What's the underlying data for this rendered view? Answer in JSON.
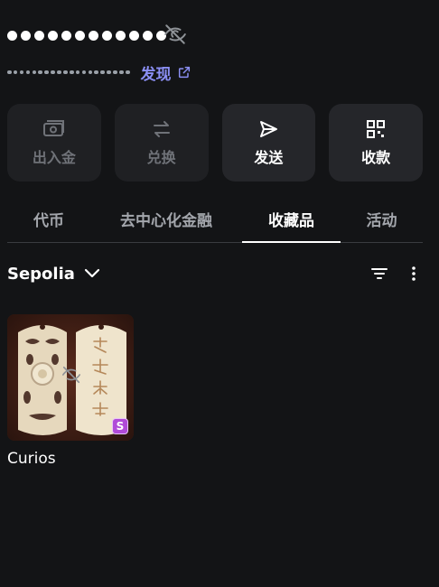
{
  "wallet": {
    "balance_hidden": true,
    "balance_dot_count": 12,
    "address_dot_count": 20,
    "discover_label": "发现"
  },
  "actions": [
    {
      "label": "出入金",
      "icon": "money-icon",
      "enabled": false
    },
    {
      "label": "兑换",
      "icon": "swap-icon",
      "enabled": false
    },
    {
      "label": "发送",
      "icon": "send-icon",
      "enabled": true
    },
    {
      "label": "收款",
      "icon": "qr-code-icon",
      "enabled": true
    }
  ],
  "tabs": [
    {
      "label": "代币",
      "active": false
    },
    {
      "label": "去中心化金融",
      "active": false
    },
    {
      "label": "收藏品",
      "active": true
    },
    {
      "label": "活动",
      "active": false
    }
  ],
  "network": {
    "name": "Sepolia"
  },
  "collectibles": [
    {
      "name": "Curios",
      "badge": "S",
      "hidden": true
    }
  ],
  "colors": {
    "background": "#131416",
    "accent_link": "#8b8ff4",
    "card": "#1f2023",
    "badge": "#b04ad8"
  }
}
